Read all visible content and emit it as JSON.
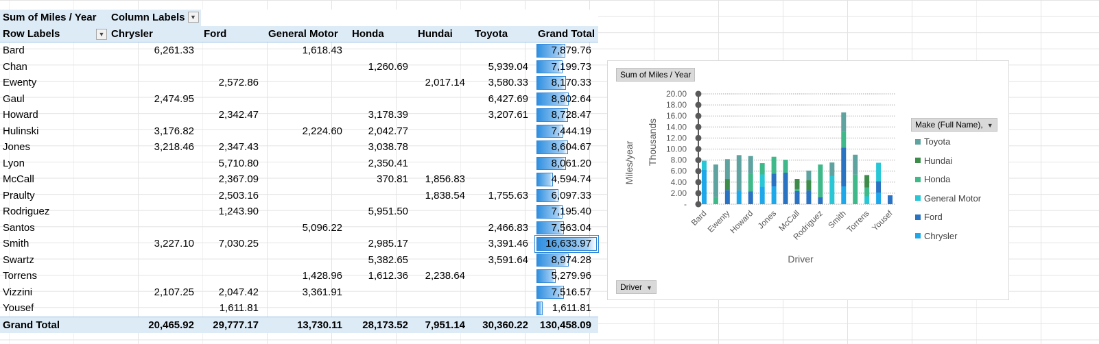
{
  "pivot": {
    "value_field": "Sum of Miles / Year",
    "column_labels": "Column Labels",
    "row_labels": "Row Labels",
    "columns": [
      "Chrysler",
      "Ford",
      "General Motor",
      "Honda",
      "Hundai",
      "Toyota",
      "Grand Total"
    ],
    "rows": [
      {
        "label": "Bard",
        "cells": [
          "6,261.33",
          "",
          "1,618.43",
          "",
          "",
          "",
          "7,879.76"
        ],
        "total": 7879.76
      },
      {
        "label": "Chan",
        "cells": [
          "",
          "",
          "",
          "1,260.69",
          "",
          "5,939.04",
          "7,199.73"
        ],
        "total": 7199.73
      },
      {
        "label": "Ewenty",
        "cells": [
          "",
          "2,572.86",
          "",
          "",
          "2,017.14",
          "3,580.33",
          "8,170.33"
        ],
        "total": 8170.33
      },
      {
        "label": "Gaul",
        "cells": [
          "2,474.95",
          "",
          "",
          "",
          "",
          "6,427.69",
          "8,902.64"
        ],
        "total": 8902.64
      },
      {
        "label": "Howard",
        "cells": [
          "",
          "2,342.47",
          "",
          "3,178.39",
          "",
          "3,207.61",
          "8,728.47"
        ],
        "total": 8728.47
      },
      {
        "label": "Hulinski",
        "cells": [
          "3,176.82",
          "",
          "2,224.60",
          "2,042.77",
          "",
          "",
          "7,444.19"
        ],
        "total": 7444.19
      },
      {
        "label": "Jones",
        "cells": [
          "3,218.46",
          "2,347.43",
          "",
          "3,038.78",
          "",
          "",
          "8,604.67"
        ],
        "total": 8604.67
      },
      {
        "label": "Lyon",
        "cells": [
          "",
          "5,710.80",
          "",
          "2,350.41",
          "",
          "",
          "8,061.20"
        ],
        "total": 8061.2
      },
      {
        "label": "McCall",
        "cells": [
          "",
          "2,367.09",
          "",
          "370.81",
          "1,856.83",
          "",
          "4,594.74"
        ],
        "total": 4594.74
      },
      {
        "label": "Praulty",
        "cells": [
          "",
          "2,503.16",
          "",
          "",
          "1,838.54",
          "1,755.63",
          "6,097.33"
        ],
        "total": 6097.33
      },
      {
        "label": "Rodriguez",
        "cells": [
          "",
          "1,243.90",
          "",
          "5,951.50",
          "",
          "",
          "7,195.40"
        ],
        "total": 7195.4
      },
      {
        "label": "Santos",
        "cells": [
          "",
          "",
          "5,096.22",
          "",
          "",
          "2,466.83",
          "7,563.04"
        ],
        "total": 7563.04
      },
      {
        "label": "Smith",
        "cells": [
          "3,227.10",
          "7,030.25",
          "",
          "2,985.17",
          "",
          "3,391.46",
          "16,633.97"
        ],
        "total": 16633.97
      },
      {
        "label": "Swartz",
        "cells": [
          "",
          "",
          "",
          "5,382.65",
          "",
          "3,591.64",
          "8,974.28"
        ],
        "total": 8974.28
      },
      {
        "label": "Torrens",
        "cells": [
          "",
          "",
          "1,428.96",
          "1,612.36",
          "2,238.64",
          "",
          "5,279.96"
        ],
        "total": 5279.96
      },
      {
        "label": "Vizzini",
        "cells": [
          "2,107.25",
          "2,047.42",
          "3,361.91",
          "",
          "",
          "",
          "7,516.57"
        ],
        "total": 7516.57
      },
      {
        "label": "Yousef",
        "cells": [
          "",
          "1,611.81",
          "",
          "",
          "",
          "",
          "1,611.81"
        ],
        "total": 1611.81
      }
    ],
    "grand_total_label": "Grand Total",
    "grand_totals": [
      "20,465.92",
      "29,777.17",
      "13,730.11",
      "28,173.52",
      "7,951.14",
      "30,360.22",
      "130,458.09"
    ],
    "databar_max": 16633.97
  },
  "chart": {
    "value_button": "Sum of Miles / Year",
    "axis_button": "Driver",
    "legend_button": "Make (Full Name),",
    "display_unit": "Thousands",
    "ylabel": "Miles/year",
    "xlabel": "Driver",
    "y_ticks": [
      "20.00",
      "18.00",
      "16.00",
      "14.00",
      "12.00",
      "10.00",
      "8.00",
      "6.00",
      "4.00",
      "2.00",
      "-"
    ],
    "x_tick_labels": [
      "Bard",
      "",
      "Ewenty",
      "",
      "Howard",
      "",
      "Jones",
      "",
      "McCall",
      "",
      "Rodriguez",
      "",
      "Smith",
      "",
      "Torrens",
      "",
      "Yousef"
    ],
    "legend": [
      {
        "name": "Toyota",
        "color": "#5fa3a0"
      },
      {
        "name": "Hundai",
        "color": "#3d8c4a"
      },
      {
        "name": "Honda",
        "color": "#3fb98a"
      },
      {
        "name": "General Motor",
        "color": "#29c7d6"
      },
      {
        "name": "Ford",
        "color": "#2a72c2"
      },
      {
        "name": "Chrysler",
        "color": "#1ea8ea"
      }
    ]
  },
  "chart_data": {
    "type": "bar",
    "stacked": true,
    "categories": [
      "Bard",
      "Chan",
      "Ewenty",
      "Gaul",
      "Howard",
      "Hulinski",
      "Jones",
      "Lyon",
      "McCall",
      "Praulty",
      "Rodriguez",
      "Santos",
      "Smith",
      "Swartz",
      "Torrens",
      "Vizzini",
      "Yousef"
    ],
    "series": [
      {
        "name": "Chrysler",
        "values": [
          6.26133,
          0,
          0,
          2.47495,
          0,
          3.17682,
          3.21846,
          0,
          0,
          0,
          0,
          0,
          3.2271,
          0,
          0,
          2.10725,
          0
        ]
      },
      {
        "name": "Ford",
        "values": [
          0,
          0,
          2.57286,
          0,
          2.34247,
          0,
          2.34743,
          5.7108,
          2.36709,
          2.50316,
          1.2439,
          0,
          7.03025,
          0,
          0,
          2.04742,
          1.61181
        ]
      },
      {
        "name": "General Motor",
        "values": [
          1.61843,
          0,
          0,
          0,
          0,
          2.2246,
          0,
          0,
          0,
          0,
          0,
          5.09622,
          0,
          0,
          1.42896,
          3.36191,
          0
        ]
      },
      {
        "name": "Honda",
        "values": [
          0,
          1.26069,
          0,
          0,
          3.17839,
          2.04277,
          3.03878,
          2.35041,
          0.37081,
          0,
          5.9515,
          0,
          2.98517,
          5.38265,
          1.61236,
          0,
          0
        ]
      },
      {
        "name": "Hundai",
        "values": [
          0,
          0,
          2.01714,
          0,
          0,
          0,
          0,
          0,
          1.85683,
          1.83854,
          0,
          0,
          0,
          0,
          2.23864,
          0,
          0
        ]
      },
      {
        "name": "Toyota",
        "values": [
          0,
          5.93904,
          3.58033,
          6.42769,
          3.20761,
          0,
          0,
          0,
          0,
          1.75563,
          0,
          2.46683,
          3.39146,
          3.59164,
          0,
          0,
          0
        ]
      }
    ],
    "xlabel": "Driver",
    "ylabel": "Miles/year",
    "ylim": [
      0,
      20
    ],
    "y_unit_label": "Thousands",
    "grid": true,
    "legend_position": "right"
  }
}
